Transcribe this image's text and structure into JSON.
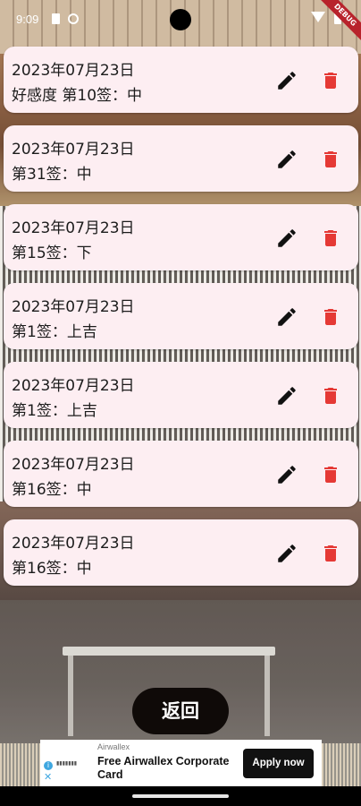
{
  "status_bar": {
    "time": "9:09",
    "debug_label": "DEBUG"
  },
  "records": [
    {
      "date": "2023年07月23日",
      "result": "好感度 第10签：中"
    },
    {
      "date": "2023年07月23日",
      "result": "第31签：中"
    },
    {
      "date": "2023年07月23日",
      "result": "第15签：下"
    },
    {
      "date": "2023年07月23日",
      "result": "第1签：上吉"
    },
    {
      "date": "2023年07月23日",
      "result": "第1签：上吉"
    },
    {
      "date": "2023年07月23日",
      "result": "第16签：中"
    },
    {
      "date": "2023年07月23日",
      "result": "第16签：中"
    }
  ],
  "icons": {
    "edit": "pencil-icon",
    "delete": "trash-icon"
  },
  "colors": {
    "card_background": "#fdeef2",
    "delete_icon": "#e53935",
    "back_button": "#0f0a08"
  },
  "back_button": {
    "label": "返回"
  },
  "ad": {
    "advertiser": "Airwallex",
    "title": "Free Airwallex Corporate Card",
    "cta": "Apply now",
    "info_icon": "info-icon",
    "close_icon": "close-icon"
  }
}
